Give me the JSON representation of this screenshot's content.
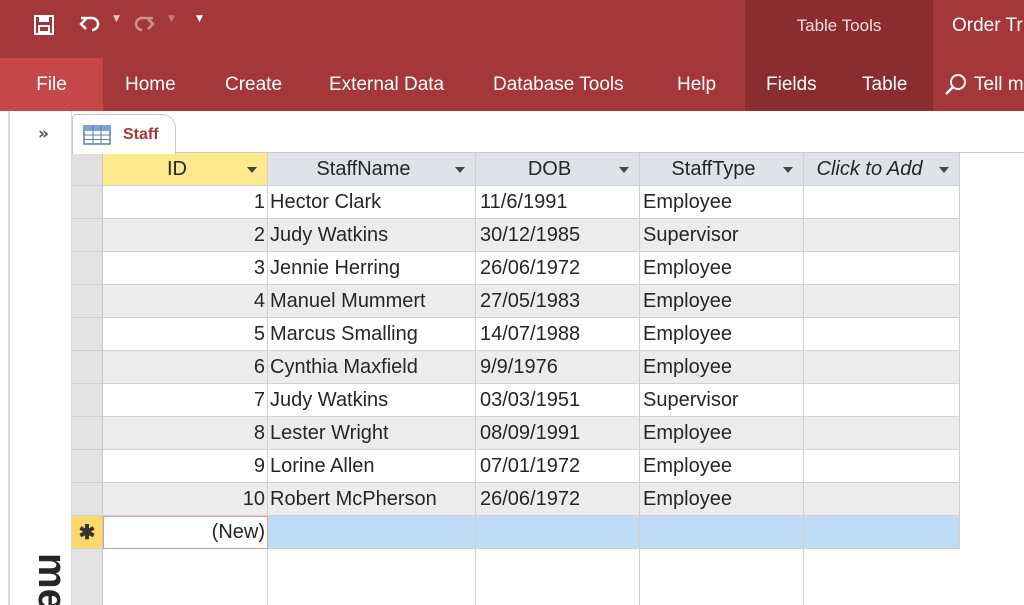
{
  "quick_access": {
    "icons": [
      "save-icon",
      "undo-icon",
      "redo-icon",
      "customize-icon"
    ]
  },
  "title_bar": {
    "contextual_group": "Table Tools",
    "document_title": "Order Tr"
  },
  "ribbon": {
    "tabs": [
      {
        "label": "File"
      },
      {
        "label": "Home"
      },
      {
        "label": "Create"
      },
      {
        "label": "External Data"
      },
      {
        "label": "Database Tools"
      },
      {
        "label": "Help"
      },
      {
        "label": "Fields"
      },
      {
        "label": "Table"
      }
    ],
    "tell_me": "Tell m"
  },
  "nav_pane": {
    "shutter": "»",
    "vertical_text": "me"
  },
  "document_tab": {
    "label": "Staff",
    "icon": "table-icon"
  },
  "table": {
    "columns": [
      "ID",
      "StaffName",
      "DOB",
      "StaffType",
      "Click to Add"
    ],
    "rows": [
      {
        "id": "1",
        "name": "Hector Clark",
        "dob": "11/6/1991",
        "type": "Employee"
      },
      {
        "id": "2",
        "name": "Judy Watkins",
        "dob": "30/12/1985",
        "type": "Supervisor"
      },
      {
        "id": "3",
        "name": "Jennie Herring",
        "dob": "26/06/1972",
        "type": "Employee"
      },
      {
        "id": "4",
        "name": "Manuel Mummert",
        "dob": "27/05/1983",
        "type": "Employee"
      },
      {
        "id": "5",
        "name": "Marcus Smalling",
        "dob": "14/07/1988",
        "type": "Employee"
      },
      {
        "id": "6",
        "name": "Cynthia Maxfield",
        "dob": "9/9/1976",
        "type": "Employee"
      },
      {
        "id": "7",
        "name": "Judy Watkins",
        "dob": "03/03/1951",
        "type": "Supervisor"
      },
      {
        "id": "8",
        "name": "Lester Wright",
        "dob": "08/09/1991",
        "type": "Employee"
      },
      {
        "id": "9",
        "name": "Lorine Allen",
        "dob": "07/01/1972",
        "type": "Employee"
      },
      {
        "id": "10",
        "name": "Robert McPherson",
        "dob": "26/06/1972",
        "type": "Employee"
      }
    ],
    "new_row": {
      "marker": "✱",
      "id_placeholder": "(New)"
    }
  },
  "colors": {
    "ribbon": "#a4373a",
    "contextual_tab": "#8b2c2e",
    "file_tab": "#c5474a",
    "header_selected": "#fde98e",
    "new_row": "#bfdcf7"
  }
}
